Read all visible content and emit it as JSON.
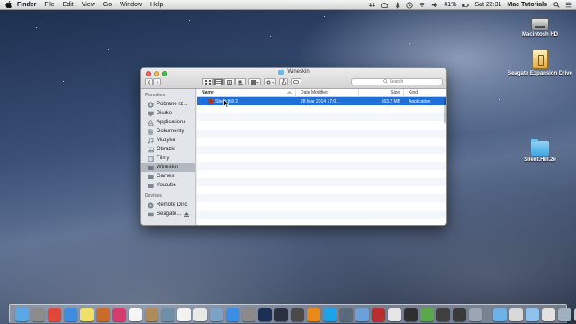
{
  "menubar": {
    "app_name": "Finder",
    "menus": [
      "File",
      "Edit",
      "View",
      "Go",
      "Window",
      "Help"
    ],
    "battery": "41%",
    "clock": "Sat 22:31",
    "user": "Mac Tutorials"
  },
  "desktop_icons": [
    {
      "label": "Macintosh HD",
      "icon": "hard-drive-icon"
    },
    {
      "label": "Seagate Expansion Drive",
      "icon": "external-drive-icon"
    },
    {
      "label": "Silent.Hill.2e",
      "icon": "folder-icon"
    }
  ],
  "window": {
    "title": "Wineskin",
    "search_placeholder": "Search",
    "sidebar": {
      "favorites_heading": "Favorites",
      "favorites": [
        {
          "label": "Pobrane rz...",
          "icon": "downloads-icon"
        },
        {
          "label": "Biurko",
          "icon": "desktop-icon"
        },
        {
          "label": "Applications",
          "icon": "applications-icon"
        },
        {
          "label": "Dokumenty",
          "icon": "documents-icon"
        },
        {
          "label": "Muzyka",
          "icon": "music-icon"
        },
        {
          "label": "Obrazki",
          "icon": "pictures-icon"
        },
        {
          "label": "Filmy",
          "icon": "movies-icon"
        },
        {
          "label": "Wineskin",
          "icon": "folder-icon",
          "selected": true
        },
        {
          "label": "Games",
          "icon": "folder-icon"
        },
        {
          "label": "Youtube",
          "icon": "folder-icon"
        }
      ],
      "devices_heading": "Devices",
      "devices": [
        {
          "label": "Remote Disc",
          "icon": "remote-disc-icon"
        },
        {
          "label": "Seagate...",
          "icon": "external-drive-icon"
        }
      ]
    },
    "columns": {
      "name": "Name",
      "date": "Date Modified",
      "size": "Size",
      "kind": "Kind"
    },
    "files": [
      {
        "name": "Silent Hill 2",
        "date": "28 Mar 2014 17:01",
        "size": "163,2 MB",
        "kind": "Application"
      }
    ]
  },
  "dock": {
    "apps": [
      {
        "name": "finder-icon",
        "color": "#5aa9e6"
      },
      {
        "name": "launchpad-icon",
        "color": "#8c8c8c"
      },
      {
        "name": "chrome-icon",
        "color": "#e0463a"
      },
      {
        "name": "safari-icon",
        "color": "#3d8ce0"
      },
      {
        "name": "stickies-icon",
        "color": "#f0e06a"
      },
      {
        "name": "pencil-icon",
        "color": "#c96c2c"
      },
      {
        "name": "itunes-icon",
        "color": "#d63b6e"
      },
      {
        "name": "calendar-icon",
        "color": "#f5f5f5"
      },
      {
        "name": "contacts-icon",
        "color": "#b08b5a"
      },
      {
        "name": "photo-icon",
        "color": "#6f8fa8"
      },
      {
        "name": "notes-icon",
        "color": "#f2f2f2"
      },
      {
        "name": "textedit-icon",
        "color": "#e8e8e8"
      },
      {
        "name": "preview-icon",
        "color": "#7ea2c6"
      },
      {
        "name": "app-store-icon",
        "color": "#3b8ee6"
      },
      {
        "name": "settings-icon",
        "color": "#8a8a8a"
      },
      {
        "name": "photoshop-icon",
        "color": "#1b2f54"
      },
      {
        "name": "lightroom-icon",
        "color": "#2c3140"
      },
      {
        "name": "finalcut-icon",
        "color": "#4a4a4a"
      },
      {
        "name": "vlc-icon",
        "color": "#e88a1a"
      },
      {
        "name": "skype-icon",
        "color": "#1fa3e8"
      },
      {
        "name": "sound-icon",
        "color": "#5a6a7a"
      },
      {
        "name": "mail-icon",
        "color": "#6ba0d8"
      },
      {
        "name": "red-app-icon",
        "color": "#b82e2e"
      },
      {
        "name": "clock-icon",
        "color": "#e6e6e6"
      },
      {
        "name": "video-icon",
        "color": "#2f2f2f"
      },
      {
        "name": "green-app-icon",
        "color": "#5aa84a"
      },
      {
        "name": "media-icon",
        "color": "#3f3f3f"
      },
      {
        "name": "clapper-icon",
        "color": "#3a3a3a"
      },
      {
        "name": "player-icon",
        "color": "#9aa6b3"
      }
    ],
    "stacks": [
      {
        "name": "applications-folder-icon",
        "color": "#6fb2e6"
      },
      {
        "name": "documents-stack-icon",
        "color": "#d9d9d9"
      },
      {
        "name": "downloads-stack-icon",
        "color": "#8fc2ea"
      },
      {
        "name": "screenshot-stack-icon",
        "color": "#e2e2e2"
      },
      {
        "name": "image-stack-icon",
        "color": "#9fb0bf"
      },
      {
        "name": "trash-icon",
        "color": "#c8c8c8"
      }
    ]
  },
  "colors": {
    "selection": "#1f6fd8",
    "sidebar_selected": "#b3b9c1"
  }
}
